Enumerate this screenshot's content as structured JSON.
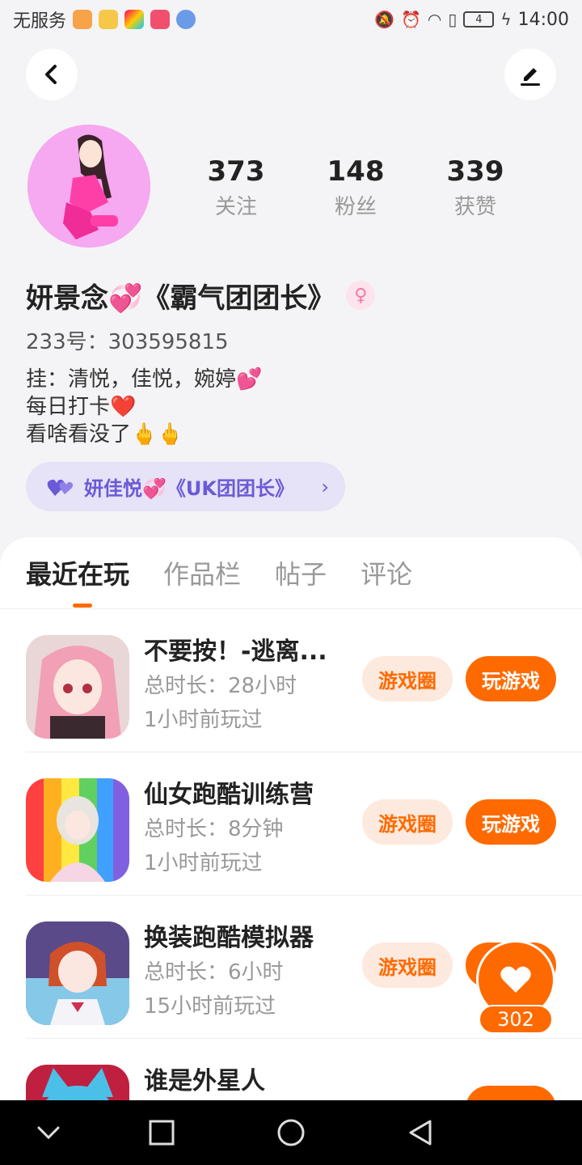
{
  "status_bar": {
    "carrier": "无服务",
    "time": "14:00",
    "battery": "4"
  },
  "profile": {
    "stats": [
      {
        "value": "373",
        "label": "关注"
      },
      {
        "value": "148",
        "label": "粉丝"
      },
      {
        "value": "339",
        "label": "获赞"
      }
    ],
    "nickname": "妍景念💞《霸气团团长》",
    "account_id": "233号：303595815",
    "bio": [
      "挂：清悦，佳悦，婉婷💕",
      "每日打卡❤️",
      "看啥看没了🖕🖕"
    ],
    "relation": "妍佳悦💞《UK团团长》",
    "gender_symbol": "♀"
  },
  "tabs": [
    "最近在玩",
    "作品栏",
    "帖子",
    "评论"
  ],
  "games": [
    {
      "title": "不要按！-逃离...",
      "duration": "总时长：28小时",
      "last_played": "1小时前玩过"
    },
    {
      "title": "仙女跑酷训练营",
      "duration": "总时长：8分钟",
      "last_played": "1小时前玩过"
    },
    {
      "title": "换装跑酷模拟器",
      "duration": "总时长：6小时",
      "last_played": "15小时前玩过"
    },
    {
      "title": "谁是外星人",
      "duration": "",
      "last_played": ""
    }
  ],
  "buttons": {
    "game_circle": "游戏圈",
    "play_game": "玩游戏"
  },
  "like_count": "302",
  "colors": {
    "accent": "#ff6a00",
    "accent_light": "#fde9dd",
    "relation_bg": "#e6e2f7",
    "relation_text": "#6a5ad6"
  }
}
